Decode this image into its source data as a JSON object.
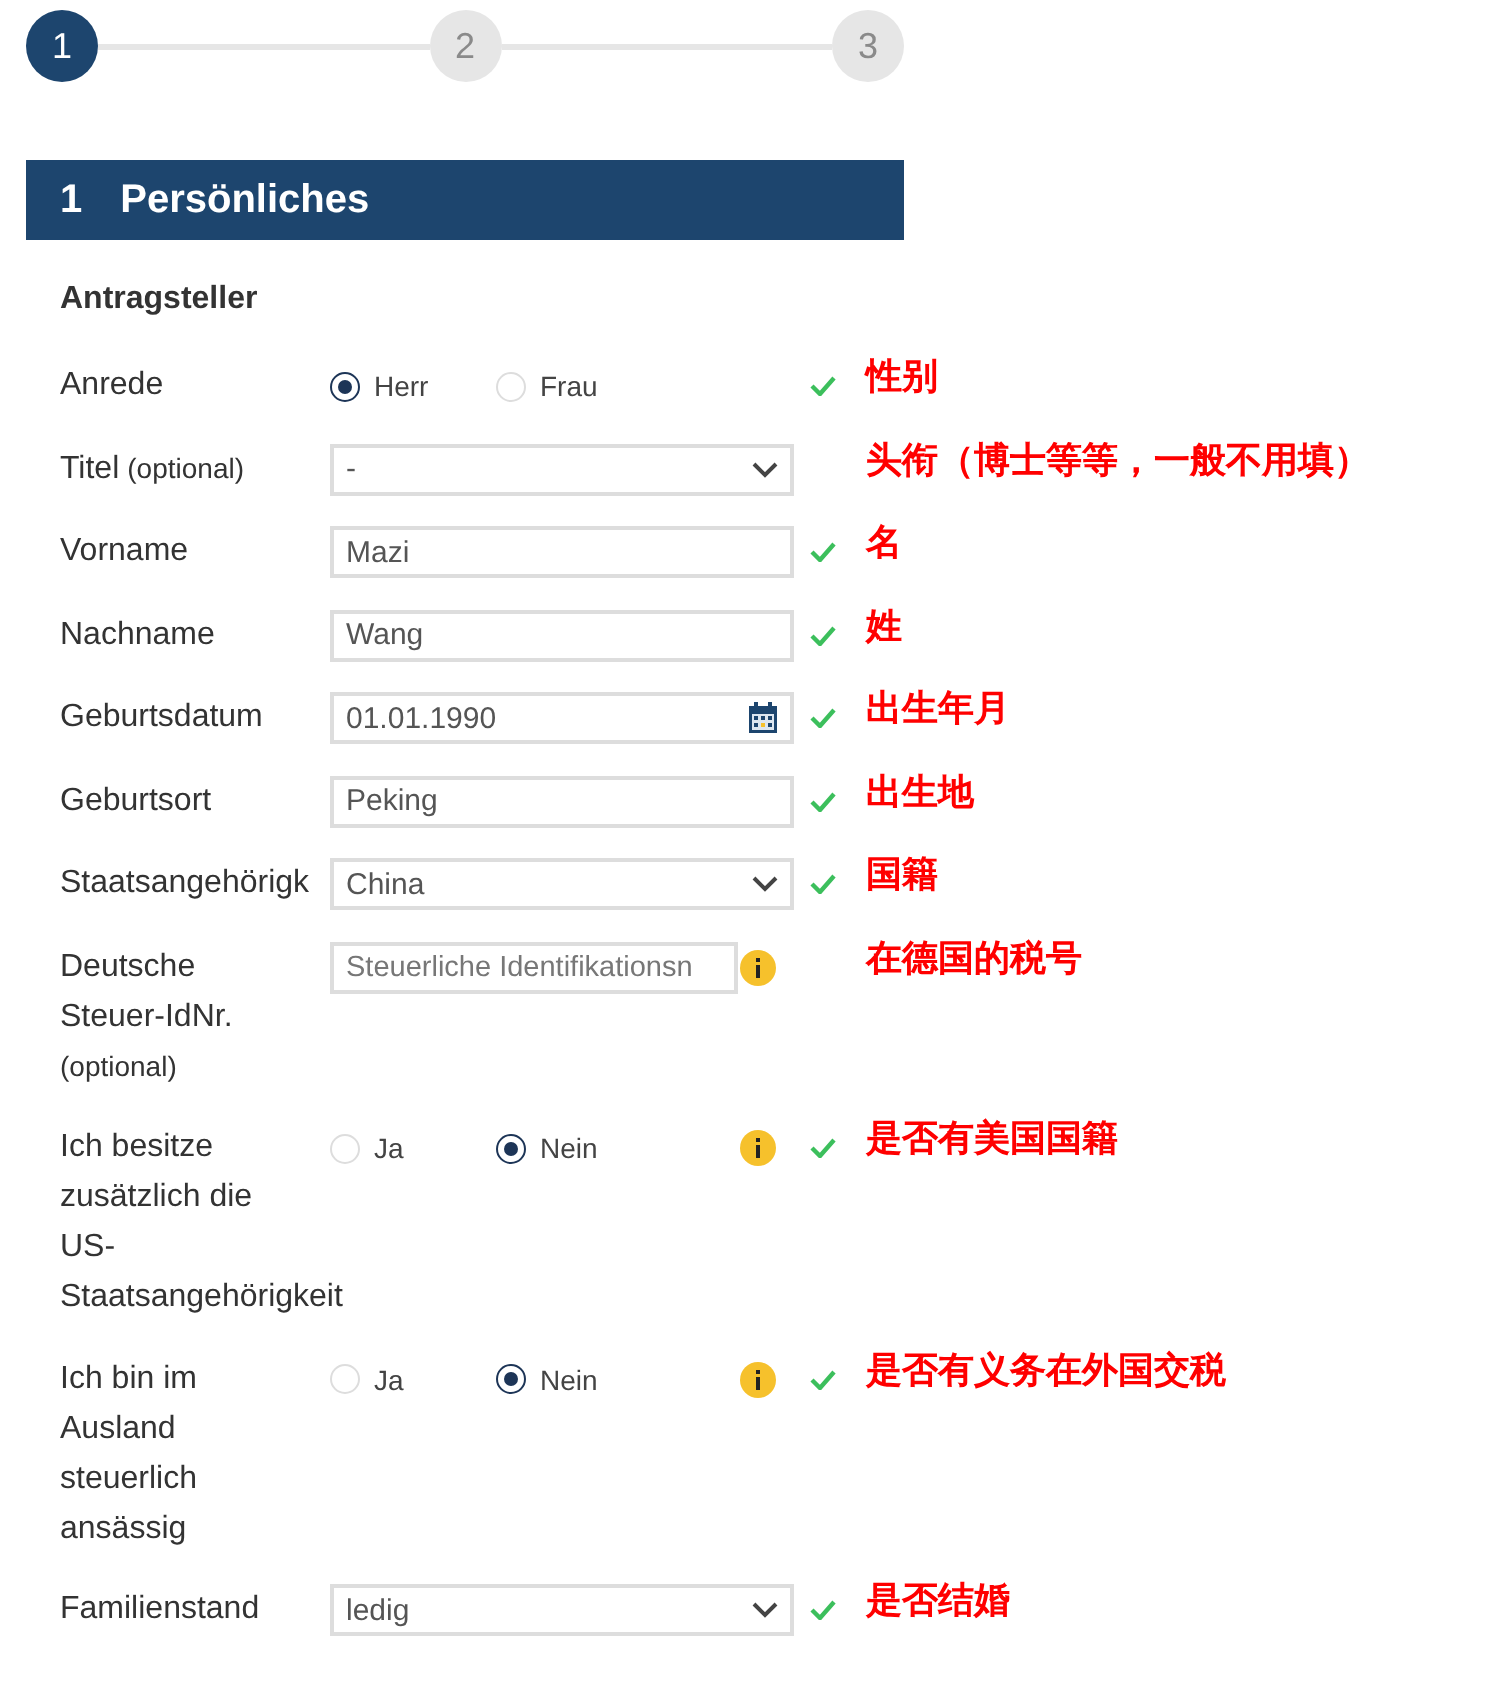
{
  "steps": [
    {
      "label": "1",
      "selected": true
    },
    {
      "label": "2",
      "selected": false
    },
    {
      "label": "3",
      "selected": false
    }
  ],
  "section": {
    "number": "1",
    "title": "Persönliches"
  },
  "subtitle": "Antragsteller",
  "rows": [
    {
      "kind": "radio",
      "label": [
        "Anrede"
      ],
      "options": [
        {
          "label": "Herr",
          "selected": true
        },
        {
          "label": "Frau",
          "selected": false
        }
      ],
      "info": false,
      "valid": true,
      "annotation": "性别"
    },
    {
      "kind": "select",
      "label": [
        "Titel"
      ],
      "label_note": "(optional)",
      "value": "-",
      "info": false,
      "valid": false,
      "annotation": "头衔（博士等等，一般不用填）"
    },
    {
      "kind": "text",
      "label": [
        "Vorname"
      ],
      "value": "Mazi",
      "info": false,
      "valid": true,
      "annotation": "名"
    },
    {
      "kind": "text",
      "label": [
        "Nachname"
      ],
      "value": "Wang",
      "info": false,
      "valid": true,
      "annotation": "姓"
    },
    {
      "kind": "date",
      "label": [
        "Geburtsdatum"
      ],
      "value": "01.01.1990",
      "info": false,
      "valid": true,
      "annotation": "出生年月"
    },
    {
      "kind": "text",
      "label": [
        "Geburtsort"
      ],
      "value": "Peking",
      "info": false,
      "valid": true,
      "annotation": "出生地"
    },
    {
      "kind": "select",
      "label": [
        "Staatsangehörigk"
      ],
      "value": "China",
      "info": false,
      "valid": true,
      "annotation": "国籍"
    },
    {
      "kind": "text",
      "label": [
        "Deutsche",
        "Steuer-IdNr."
      ],
      "label_note": "(optional)",
      "placeholder": "Steuerliche Identifikationsn",
      "info": true,
      "valid": false,
      "annotation": "在德国的税号"
    },
    {
      "kind": "radio",
      "label": [
        "Ich besitze",
        "zusätzlich die",
        "US-",
        "Staatsangehörigkeit"
      ],
      "options": [
        {
          "label": "Ja",
          "selected": false
        },
        {
          "label": "Nein",
          "selected": true
        }
      ],
      "info": true,
      "valid": true,
      "annotation": "是否有美国国籍"
    },
    {
      "kind": "radio",
      "label": [
        "Ich bin im",
        "Ausland",
        "steuerlich",
        "ansässig"
      ],
      "options": [
        {
          "label": "Ja",
          "selected": false
        },
        {
          "label": "Nein",
          "selected": true
        }
      ],
      "info": true,
      "valid": true,
      "annotation": "是否有义务在外国交税"
    },
    {
      "kind": "select",
      "label": [
        "Familienstand"
      ],
      "value": "ledig",
      "info": false,
      "valid": true,
      "annotation": "是否结婚"
    }
  ]
}
